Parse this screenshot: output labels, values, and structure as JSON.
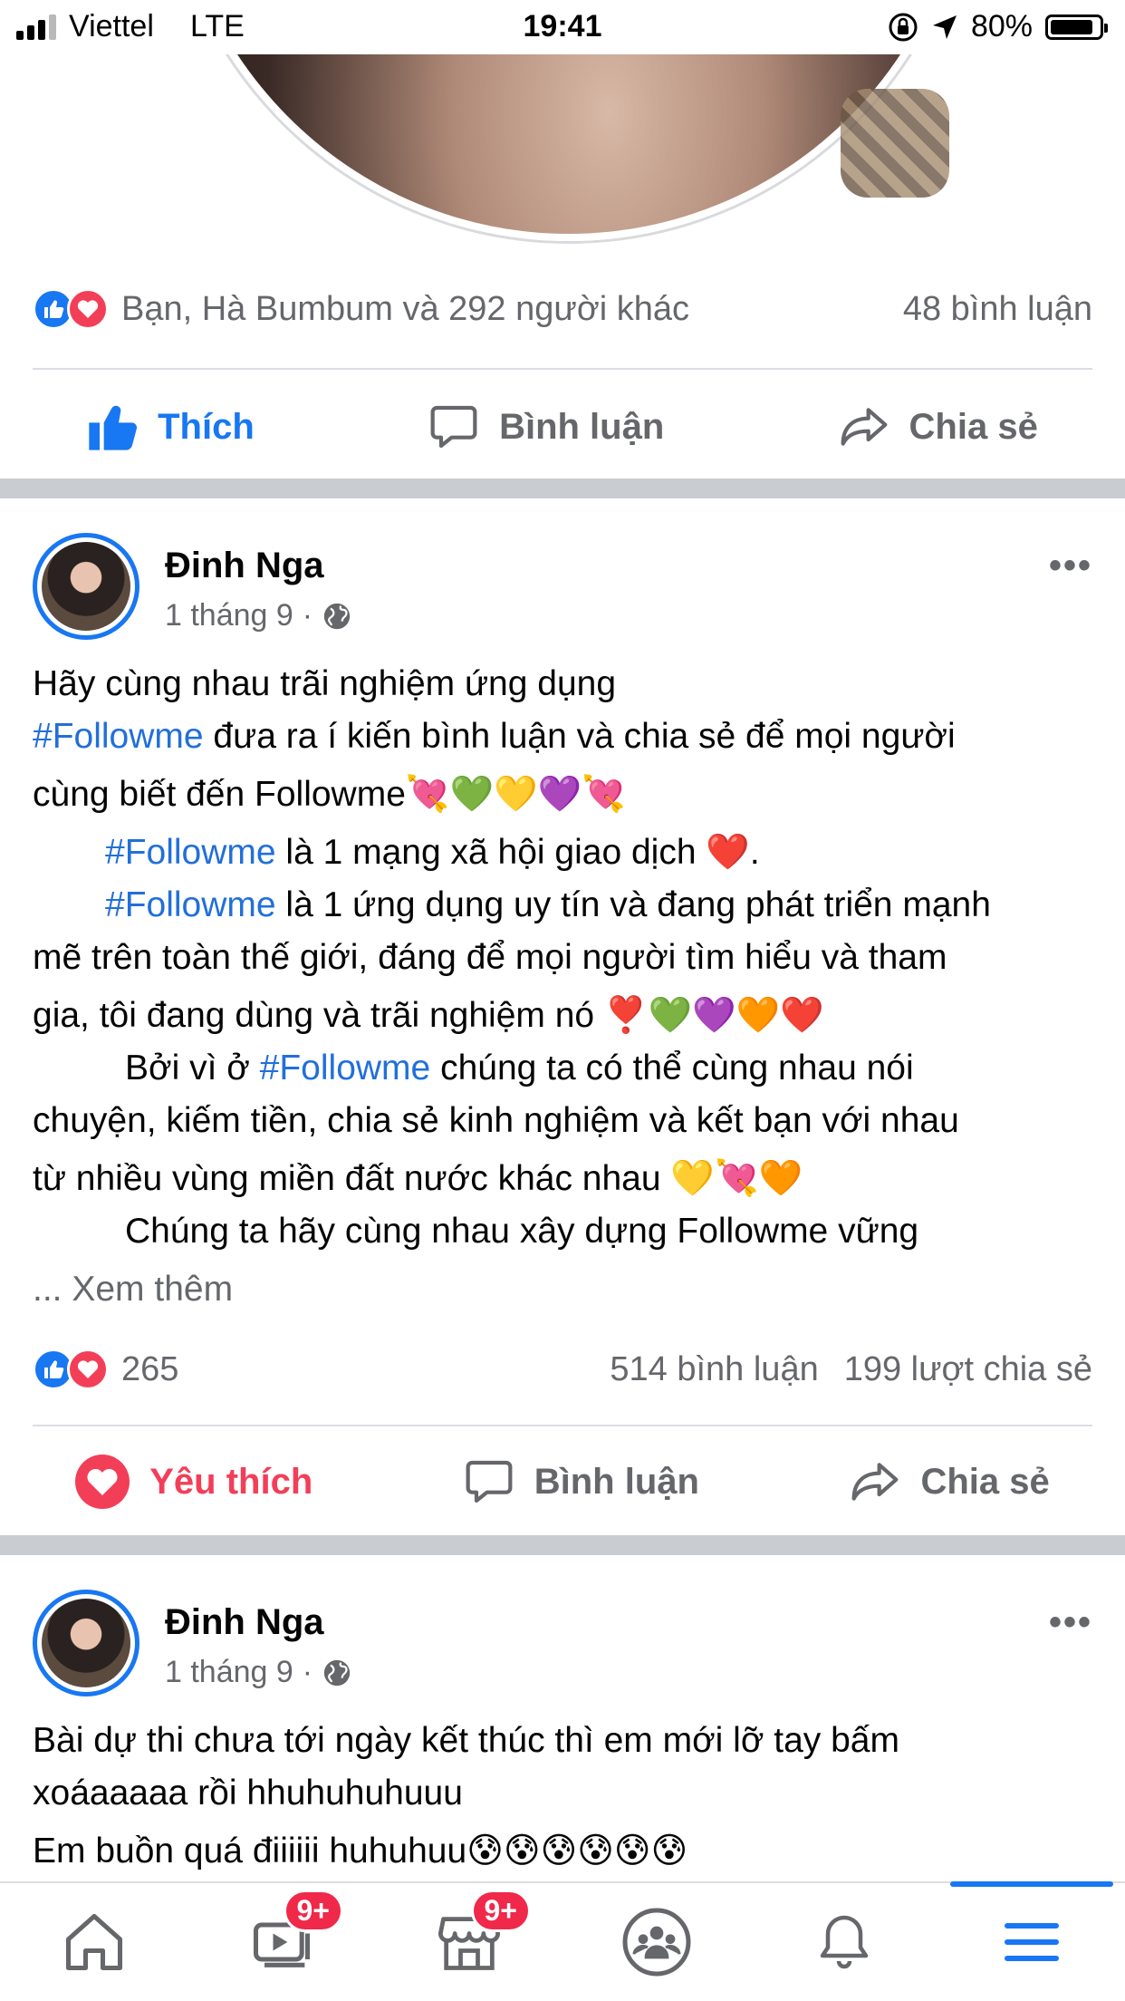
{
  "status_bar": {
    "carrier": "Viettel",
    "network": "LTE",
    "time": "19:41",
    "battery": "80%"
  },
  "post1": {
    "reactions_text": "Bạn, Hà Bumbum và 292 người khác",
    "comments": "48 bình luận",
    "actions": {
      "like": "Thích",
      "comment": "Bình luận",
      "share": "Chia sẻ"
    }
  },
  "post2": {
    "author": "Đinh Nga",
    "date": "1 tháng 9",
    "lines": {
      "l1": "Hãy cùng nhau trãi nghiệm ứng dụng",
      "l2_tag": "#Followme",
      "l2": "  đưa ra í kiến bình luận và chia sẻ để mọi người",
      "l3": "cùng biết đến Followme💘💚💛💜💘",
      "l4_tag": "#Followme",
      "l4": " là 1 mạng xã hội giao dịch ❤️.",
      "l5_tag": "#Followme",
      "l5": " là 1 ứng dụng uy tín và đang phát triển mạnh",
      "l6": "mẽ trên toàn thế giới, đáng để mọi người tìm hiểu và tham",
      "l7": "gia, tôi đang dùng và trãi nghiệm nó ❣️💚💜🧡❤️",
      "l8_pre": "Bởi vì ở ",
      "l8_tag": "#Followme",
      "l8": " chúng ta có thể cùng nhau   nói",
      "l9": "chuyện, kiếm tiền, chia sẻ kinh nghiệm và kết bạn với nhau",
      "l10": "từ nhiều vùng miền đất nước khác nhau 💛💘🧡",
      "l11": "Chúng ta hãy cùng nhau xây dựng Followme vững",
      "see_more": "... Xem thêm"
    },
    "reaction_count": "265",
    "comments": "514 bình luận",
    "shares": "199 lượt chia sẻ",
    "actions": {
      "love": "Yêu thích",
      "comment": "Bình luận",
      "share": "Chia sẻ"
    }
  },
  "post3": {
    "author": "Đinh Nga",
    "date": "1 tháng 9",
    "l1": "Bài dự thi chưa tới ngày kết thúc thì em mới lỡ tay bấm",
    "l2": "xoáaaaaa rồi hhuhuhuhuuu",
    "l3": "Em buồn quá điiiiii huhuhuu😰😰😰😰😰😰"
  },
  "tab_bar": {
    "items": [
      "home-icon",
      "watch-icon",
      "marketplace-icon",
      "groups-icon",
      "bell-icon",
      "menu-icon"
    ],
    "watch_badge": "9+",
    "marketplace_badge": "9+"
  },
  "colors": {
    "facebook_blue": "#1877f2",
    "love_red": "#f33e58",
    "secondary_text": "#65676b",
    "hashtag": "#216fdb"
  }
}
